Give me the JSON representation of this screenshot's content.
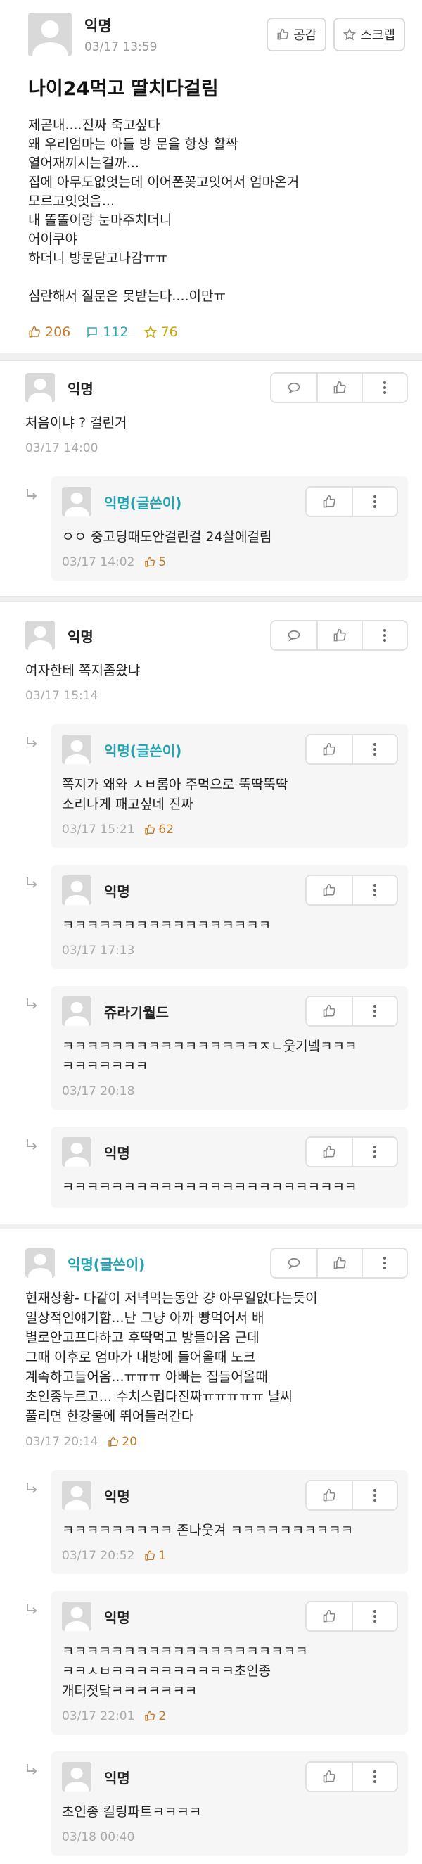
{
  "post": {
    "author": "익명",
    "time": "03/17 13:59",
    "like_button": "공감",
    "scrap_button": "스크랩",
    "title": "나이24먹고 딸치다걸림",
    "body": [
      "제곧내....진짜 죽고싶다",
      "왜 우리엄마는 아들 방 문을 항상 활짝",
      "열어재끼시는걸까...",
      "집에 아무도없엇는데 이어폰꽂고잇어서 엄마온거",
      "모르고잇엇음...",
      "내 똘똘이랑 눈마주치더니",
      "어이쿠야",
      "하더니 방문닫고나감ㅠㅠ",
      "",
      "심란해서 질문은 못받는다....이만ㅠ"
    ],
    "likes": "206",
    "comments": "112",
    "scraps": "76"
  },
  "threads": [
    {
      "comment": {
        "author": "익명",
        "op": false,
        "text": [
          "처음이냐 ? 걸린거"
        ],
        "time": "03/17 14:00",
        "likes": ""
      },
      "replies": [
        {
          "author": "익명(글쓴이)",
          "op": true,
          "text": [
            "ㅇㅇ 중고딩때도안걸린걸 24살에걸림"
          ],
          "time": "03/17 14:02",
          "likes": "5"
        }
      ]
    },
    {
      "comment": {
        "author": "익명",
        "op": false,
        "text": [
          "여자한테 쪽지좀왔냐"
        ],
        "time": "03/17 15:14",
        "likes": ""
      },
      "replies": [
        {
          "author": "익명(글쓴이)",
          "op": true,
          "text": [
            "쪽지가 왜와 ㅅㅂ롬아 주먹으로 뚝딱뚝딱",
            "소리나게 패고싶네 진짜"
          ],
          "time": "03/17 15:21",
          "likes": "62"
        },
        {
          "author": "익명",
          "op": false,
          "text": [
            "ㅋㅋㅋㅋㅋㅋㅋㅋㅋㅋㅋㅋㅋㅋㅋㅋㅋ"
          ],
          "time": "03/17 17:13",
          "likes": ""
        },
        {
          "author": "쥬라기월드",
          "op": false,
          "text": [
            "ㅋㅋㅋㅋㅋㅋㅋㅋㅋㅋㅋㅋㅋㅋㅋㅋㅈㄴ웃기넼ㅋㅋㅋ",
            "ㅋㅋㅋㅋㅋㅋㅋ"
          ],
          "time": "03/17 20:18",
          "likes": ""
        },
        {
          "author": "익명",
          "op": false,
          "text": [
            "ㅋㅋㅋㅋㅋㅋㅋㅋㅋㅋㅋㅋㅋㅋㅋㅋㅋㅋㅋㅋㅋㅋㅋㅋ"
          ],
          "time": "",
          "likes": ""
        }
      ]
    },
    {
      "comment": {
        "author": "익명(글쓴이)",
        "op": true,
        "text": [
          "현재상황- 다같이 저녁먹는동안 걍 아무일없다는듯이",
          "일상적인얘기함...난 그냥 아까 빵먹어서 배",
          "별로안고프다하고 후딱먹고 방들어옴 근데",
          "그때 이후로 엄마가 내방에 들어올때 노크",
          "계속하고들어옴...ㅠㅠㅠ 아빠는 집들어올때",
          "초인종누르고... 수치스럽다진짜ㅠㅠㅠㅠㅠ 날씨",
          "풀리면 한강물에 뛰어들러간다"
        ],
        "time": "03/17 20:14",
        "likes": "20"
      },
      "replies": [
        {
          "author": "익명",
          "op": false,
          "text": [
            "ㅋㅋㅋㅋㅋㅋㅋㅋㅋ 존나웃겨 ㅋㅋㅋㅋㅋㅋㅋㅋㅋㅋ"
          ],
          "time": "03/17 20:52",
          "likes": "1"
        },
        {
          "author": "익명",
          "op": false,
          "text": [
            "ㅋㅋㅋㅋㅋㅋㅋㅋㅋㅋㅋㅋㅋㅋㅋㅋㅋㅋㅋㅋ",
            "ㅋㅋㅅㅂㅋㅋㅋㅋㅋㅋㅋㅋㅋㅋ초인종",
            "개터졋닼ㅋㅋㅋㅋㅋㅋㅋ"
          ],
          "time": "03/17 22:01",
          "likes": "2"
        },
        {
          "author": "익명",
          "op": false,
          "text": [
            "초인종 킬링파트ㅋㅋㅋㅋ"
          ],
          "time": "03/18 00:40",
          "likes": ""
        }
      ]
    }
  ],
  "colors": {
    "op_name": "#21a3b3",
    "like": "#c07a2a",
    "comment": "#2aa6b5",
    "scrap": "#c8a800"
  },
  "icons": [
    "thumbs-up-icon",
    "speech-bubble-icon",
    "star-icon",
    "more-vertical-icon",
    "reply-arrow-icon",
    "avatar-icon"
  ]
}
